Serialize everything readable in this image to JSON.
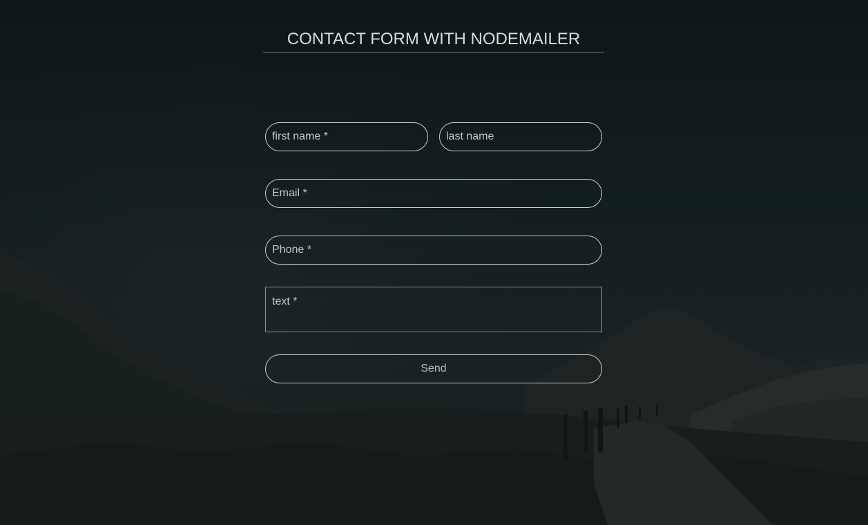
{
  "header": {
    "title": "CONTACT FORM WITH NODEMAILER"
  },
  "form": {
    "first_name_placeholder": "first name *",
    "last_name_placeholder": "last name",
    "email_placeholder": "Email *",
    "phone_placeholder": "Phone *",
    "text_placeholder": "text *",
    "send_label": "Send"
  },
  "colors": {
    "background": "#131d1f",
    "text": "#d6dcdd",
    "border": "#c8cfd0"
  }
}
